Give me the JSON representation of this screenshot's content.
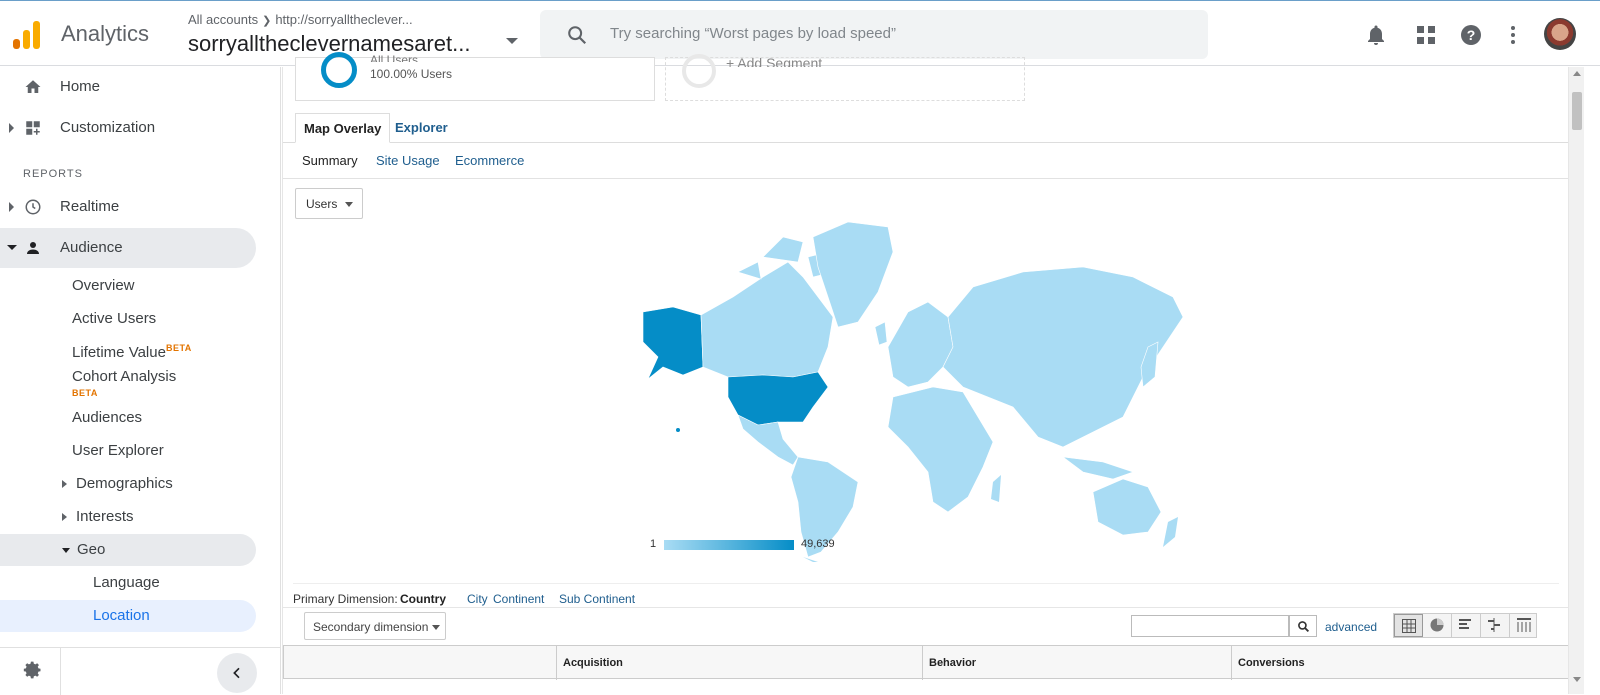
{
  "header": {
    "brand": "Analytics",
    "crumb_all": "All accounts",
    "crumb_url": "http://sorryalltheclever...",
    "property": "sorryalltheclevernamesaret...",
    "search_placeholder": "Try searching “Worst pages by load speed”",
    "icons": [
      "bell-icon",
      "apps-icon",
      "help-icon",
      "more-vert-icon"
    ],
    "logo_colors": [
      "#e37400",
      "#f9ab00",
      "#f9ab00"
    ]
  },
  "sidebar": {
    "home": "Home",
    "customization": "Customization",
    "reports_heading": "REPORTS",
    "realtime": "Realtime",
    "audience": "Audience",
    "items": {
      "overview": "Overview",
      "active_users": "Active Users",
      "lifetime_value": "Lifetime Value",
      "cohort_analysis": "Cohort Analysis",
      "audiences": "Audiences",
      "user_explorer": "User Explorer",
      "demographics": "Demographics",
      "interests": "Interests",
      "geo": "Geo",
      "language": "Language",
      "location": "Location"
    },
    "beta": "BETA"
  },
  "segments": {
    "all_users_title": "All Users",
    "all_users_pct": "100.00% Users",
    "add_segment": "+ Add Segment"
  },
  "tabs": {
    "map_overlay": "Map Overlay",
    "explorer": "Explorer"
  },
  "subtabs": {
    "summary": "Summary",
    "site_usage": "Site Usage",
    "ecommerce": "Ecommerce"
  },
  "metric_select": "Users",
  "legend": {
    "min": "1",
    "max": "49,639",
    "color_low": "#a9dcf4",
    "color_high": "#058dc7"
  },
  "primary_dimension": {
    "label": "Primary Dimension:",
    "options": [
      "Country",
      "City",
      "Continent",
      "Sub Continent"
    ],
    "selected": "Country"
  },
  "secondary_dimension": "Secondary dimension",
  "table_tools": {
    "advanced": "advanced",
    "search_value": ""
  },
  "table_headers": {
    "acquisition": "Acquisition",
    "behavior": "Behavior",
    "conversions": "Conversions"
  }
}
